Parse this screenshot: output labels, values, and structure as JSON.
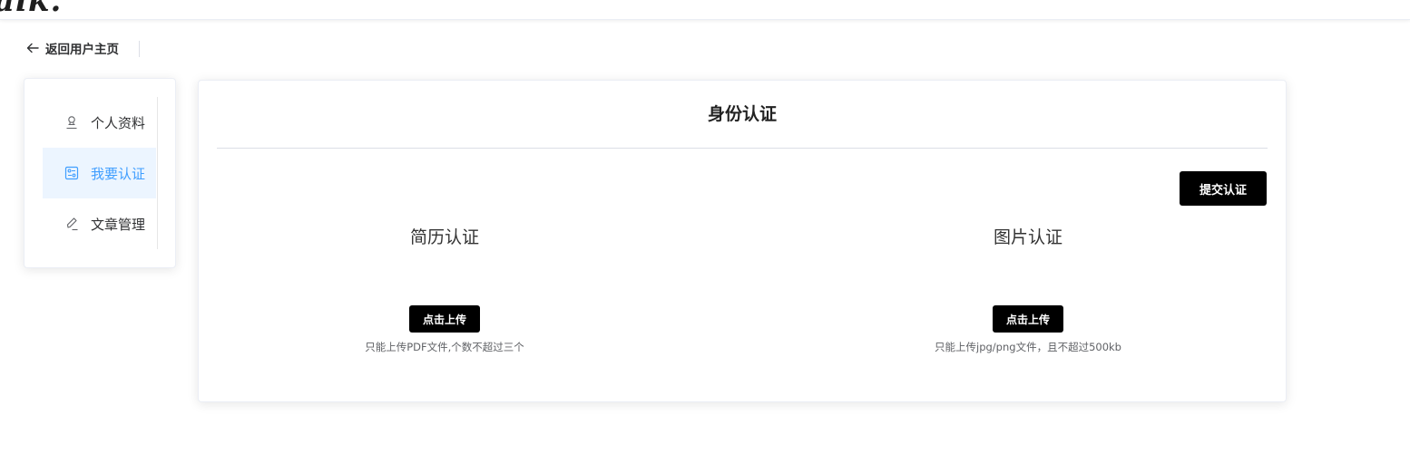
{
  "header": {
    "logo_text": "alk."
  },
  "nav": {
    "back_label": "返回用户主页"
  },
  "sidebar": {
    "items": [
      {
        "label": "个人资料",
        "icon": "user-icon",
        "active": false
      },
      {
        "label": "我要认证",
        "icon": "certificate-icon",
        "active": true
      },
      {
        "label": "文章管理",
        "icon": "edit-icon",
        "active": false
      }
    ]
  },
  "main": {
    "title": "身份认证",
    "submit_label": "提交认证",
    "sections": [
      {
        "title": "简历认证",
        "upload_label": "点击上传",
        "tip": "只能上传PDF文件,个数不超过三个"
      },
      {
        "title": "图片认证",
        "upload_label": "点击上传",
        "tip": "只能上传jpg/png文件，且不超过500kb"
      }
    ]
  },
  "colors": {
    "accent": "#409eff",
    "active_bg": "#ecf5ff",
    "button_bg": "#000000"
  }
}
